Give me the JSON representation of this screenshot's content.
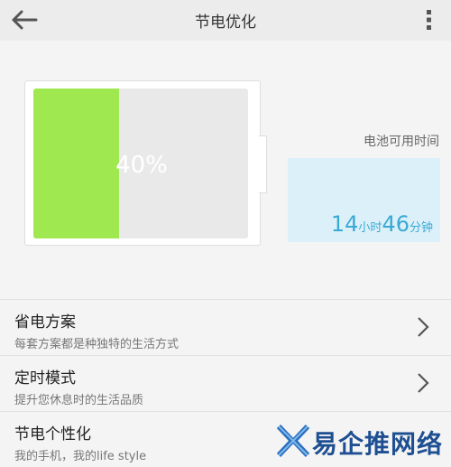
{
  "header": {
    "title": "节电优化",
    "back_icon": "arrow-left-icon",
    "more_icon": "more-vertical-icon"
  },
  "battery": {
    "percent_label": "40%",
    "level_fraction": 0.4,
    "fill_color": "#9fe850"
  },
  "remaining": {
    "label": "电池可用时间",
    "hours": "14",
    "hours_unit": "小时",
    "minutes": "46",
    "minutes_unit": "分钟"
  },
  "menu": [
    {
      "title": "省电方案",
      "subtitle": "每套方案都是种独特的生活方式"
    },
    {
      "title": "定时模式",
      "subtitle": "提升您休息时的生活品质"
    },
    {
      "title": "节电个性化",
      "subtitle": "我的手机，我的life style"
    }
  ],
  "watermark": {
    "text": "易企推网络"
  },
  "colors": {
    "accent": "#3aaad3",
    "time_box_bg": "#dcf0fa"
  }
}
